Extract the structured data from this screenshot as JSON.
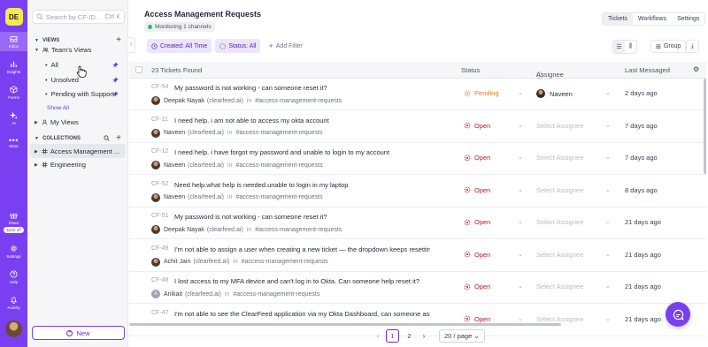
{
  "rail": {
    "workspace": "DE",
    "items": [
      {
        "label": "Inbox",
        "icon": "inbox-icon",
        "active": true
      },
      {
        "label": "Insights",
        "icon": "chart-icon"
      },
      {
        "label": "Forms",
        "icon": "box-icon"
      },
      {
        "label": "AI",
        "icon": "sparkle-icon"
      },
      {
        "label": "More",
        "icon": "dots-icon"
      }
    ],
    "bottom": [
      {
        "label": "Share",
        "icon": "gift-icon",
        "badge": "$250 off"
      },
      {
        "label": "Settings",
        "icon": "gear-icon"
      },
      {
        "label": "Help",
        "icon": "help-icon"
      },
      {
        "label": "Activity",
        "icon": "bell-icon"
      }
    ]
  },
  "sidebar": {
    "search_placeholder": "Search by CF-ID...",
    "search_shortcut": "Ctrl K",
    "views_heading": "VIEWS",
    "teams_views": "Team's Views",
    "views": [
      "All",
      "Unsolved",
      "Pending with Support"
    ],
    "show_all": "Show All",
    "my_views": "My Views",
    "collections_heading": "COLLECTIONS",
    "collections": [
      "Access Management ...",
      "Engineering"
    ],
    "new_button": "New"
  },
  "header": {
    "title": "Access Management Requests",
    "monitoring": "Monitoring 1 channels",
    "tabs": [
      "Tickets",
      "Workflows",
      "Settings"
    ],
    "active_tab": "Tickets"
  },
  "filters": {
    "created": "Created: All Time",
    "status": "Status: All",
    "add": "Add Filter",
    "group": "Group"
  },
  "table": {
    "count_label": "23 Tickets Found",
    "col_status": "Status",
    "col_assignee": "Assignee",
    "col_last": "Last Messaged",
    "rows": [
      {
        "id": "CF-54",
        "subject": "My password is not working - can someone reset it?",
        "author": "Deepak Nayak",
        "org": "(clearfeed.ai)",
        "channel": "#access-management-requests",
        "status": "Pending",
        "assignee": "Naveen",
        "last": "2 days ago"
      },
      {
        "id": "CF-11",
        "subject": "I need help. i am not able to access my okta account",
        "author": "Naveen",
        "org": "(clearfeed.ai)",
        "channel": "#access-management-requests",
        "status": "Open",
        "assignee": "Select Assignee",
        "last": "7 days ago"
      },
      {
        "id": "CF-12",
        "subject": "I need help. i have forgot my password and unable to login to my account",
        "author": "Naveen",
        "org": "(clearfeed.ai)",
        "channel": "#access-management-requests",
        "status": "Open",
        "assignee": "Select Assignee",
        "last": "7 days ago"
      },
      {
        "id": "CF-52",
        "subject": "Need help.what help is needed.unable to login in my laptop",
        "author": "Naveen",
        "org": "(clearfeed.ai)",
        "channel": "#access-management-requests",
        "status": "Open",
        "assignee": "Select Assignee",
        "last": "8 days ago"
      },
      {
        "id": "CF-51",
        "subject": "My password is not working - can someone reset it?",
        "author": "Deepak Nayak",
        "org": "(clearfeed.ai)",
        "channel": "#access-management-requests",
        "status": "Open",
        "assignee": "Select Assignee",
        "last": "21 days ago"
      },
      {
        "id": "CF-49",
        "subject": "I'm not able to assign a user when creating a new ticket — the dropdown keeps resetting to blank",
        "author": "Achit Jain",
        "org": "(clearfeed.ai)",
        "channel": "#access-management-requests",
        "status": "Open",
        "assignee": "Select Assignee",
        "last": "21 days ago"
      },
      {
        "id": "CF-48",
        "subject": "I lost access to my MFA device and can't log in to Okta. Can someone help reset it?",
        "author": "Anikait",
        "org": "(clearfeed.ai)",
        "channel": "#access-management-requests",
        "status": "Open",
        "assignee": "Select Assignee",
        "last": "21 days ago"
      },
      {
        "id": "CF-47",
        "subject": "I'm not able to see the ClearFeed application via my Okta Dashboard, can someone assign me to th...",
        "author": "",
        "org": "",
        "channel": "",
        "status": "Open",
        "assignee": "Select Assignee",
        "last": "21 days ago"
      }
    ]
  },
  "pagination": {
    "pages": [
      "1",
      "2"
    ],
    "current": "1",
    "page_size": "20 / page"
  },
  "colors": {
    "brand": "#7b3ff2",
    "open": "#b91c1c",
    "pending": "#ea7a1a"
  }
}
